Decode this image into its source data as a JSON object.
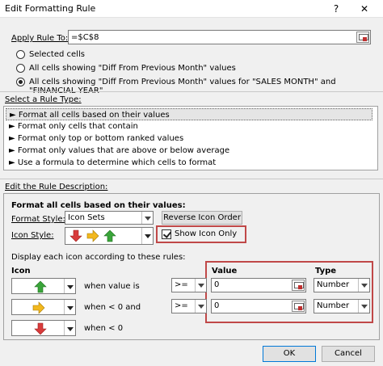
{
  "window": {
    "title": "Edit Formatting Rule",
    "help": "?",
    "close": "✕"
  },
  "apply_rule": {
    "label": "Apply Rule To:",
    "value": "=$C$8"
  },
  "scope": {
    "options": [
      "Selected cells",
      "All cells showing \"Diff From Previous Month\" values",
      "All cells showing \"Diff From Previous Month\" values for \"SALES MONTH\" and \"FINANCIAL YEAR\""
    ],
    "selected_index": 2
  },
  "rule_type": {
    "label": "Select a Rule Type:",
    "items": [
      "► Format all cells based on their values",
      "► Format only cells that contain",
      "► Format only top or bottom ranked values",
      "► Format only values that are above or below average",
      "► Use a formula to determine which cells to format"
    ],
    "selected_index": 0
  },
  "description": {
    "label": "Edit the Rule Description:",
    "heading": "Format all cells based on their values:",
    "format_style_label": "Format Style:",
    "format_style_value": "Icon Sets",
    "reverse_button": "Reverse Icon Order",
    "icon_style_label": "Icon Style:",
    "show_icon_only_label": "Show Icon Only",
    "show_icon_only_checked": true,
    "rules_caption": "Display each icon according to these rules:",
    "icon_header": "Icon",
    "value_header": "Value",
    "type_header": "Type",
    "rows": [
      {
        "icon": "green-up-arrow-icon",
        "condition": "when value is",
        "operator": ">=",
        "value": "0",
        "type": "Number"
      },
      {
        "icon": "yellow-right-arrow-icon",
        "condition": "when < 0 and",
        "operator": ">=",
        "value": "0",
        "type": "Number"
      },
      {
        "icon": "red-down-arrow-icon",
        "condition": "when < 0",
        "operator": "",
        "value": "",
        "type": ""
      }
    ]
  },
  "footer": {
    "ok": "OK",
    "cancel": "Cancel"
  },
  "colors": {
    "green": "#3aa53a",
    "yellow": "#f2b81e",
    "red": "#d83b3b",
    "highlight_border": "#c04848"
  }
}
